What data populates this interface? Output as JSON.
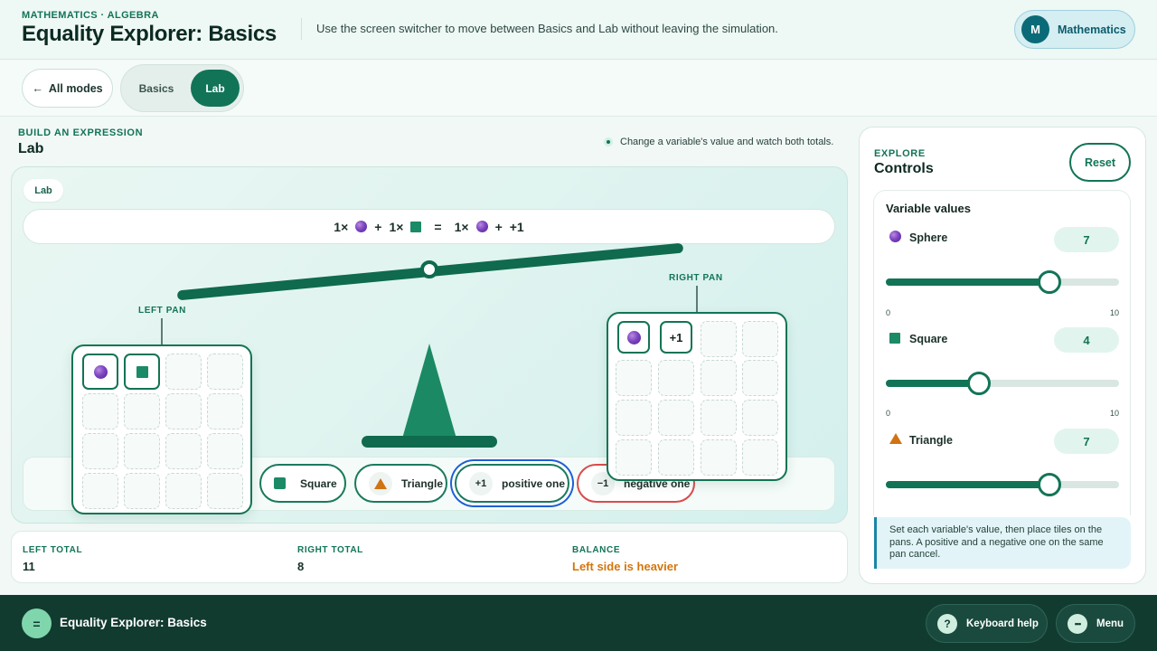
{
  "header": {
    "breadcrumb": "MATHEMATICS · ALGEBRA",
    "title": "Equality Explorer: Basics",
    "hint": "Use the screen switcher to move between Basics and Lab without leaving the simulation.",
    "subject_initial": "M",
    "subject_label": "Mathematics"
  },
  "nav": {
    "back_label": "All modes",
    "back_arrow": "←",
    "tabs": [
      {
        "label": "Basics",
        "selected": false
      },
      {
        "label": "Lab",
        "selected": true
      }
    ]
  },
  "main": {
    "section_label": "BUILD AN EXPRESSION",
    "section_title": "Lab",
    "tip": "Change a variable's value and watch both totals.",
    "stage_tag": "Lab",
    "expression": {
      "left": [
        {
          "coef": "1×",
          "icon": "sphere-icon"
        },
        {
          "op": "+"
        },
        {
          "coef": "1×",
          "icon": "square-icon"
        }
      ],
      "equals": "=",
      "right": [
        {
          "coef": "1×",
          "icon": "sphere-icon"
        },
        {
          "op": "+"
        },
        {
          "text": "+1"
        }
      ],
      "op": "+"
    },
    "left_pan_label": "LEFT PAN",
    "right_pan_label": "RIGHT PAN",
    "left_pan_tiles": [
      "sphere",
      "square"
    ],
    "right_pan_tiles": [
      "sphere",
      "+1"
    ],
    "tray": [
      {
        "icon": "square-icon",
        "label": "Square"
      },
      {
        "icon": "triangle-icon",
        "label": "Triangle"
      },
      {
        "icon_text": "+1",
        "label": "positive one",
        "focused": true
      },
      {
        "icon_text": "−1",
        "label": "negative one"
      }
    ]
  },
  "totals": {
    "left_label": "LEFT TOTAL",
    "left_value": "11",
    "right_label": "RIGHT TOTAL",
    "right_value": "8",
    "balance_label": "BALANCE",
    "balance_value": "Left side is heavier",
    "balance_color": "#d4760b"
  },
  "panel": {
    "eyebrow": "EXPLORE",
    "title": "Controls",
    "reset_label": "Reset",
    "card_title": "Variable values",
    "variables": [
      {
        "name": "Sphere",
        "icon": "sphere-icon",
        "value": 7,
        "min": "0",
        "max": "10"
      },
      {
        "name": "Square",
        "icon": "square-icon",
        "value": 4,
        "min": "0",
        "max": "10"
      },
      {
        "name": "Triangle",
        "icon": "triangle-icon",
        "value": 7,
        "min": "0",
        "max": "10"
      }
    ],
    "help_text": "Set each variable's value, then place tiles on the pans. A positive and a negative one on the same pan cancel."
  },
  "footer": {
    "logo_glyph": "=",
    "title": "Equality Explorer: Basics",
    "keyboard_icon": "?",
    "keyboard_label": "Keyboard help",
    "menu_icon": "•••",
    "menu_label": "Menu"
  },
  "colors": {
    "accent": "#127457",
    "sphere": "#7e45c2",
    "square": "#1a8a67",
    "triangle": "#d17312",
    "focus_ring": "#1d5fd6",
    "negative_border": "#d94c4c"
  }
}
